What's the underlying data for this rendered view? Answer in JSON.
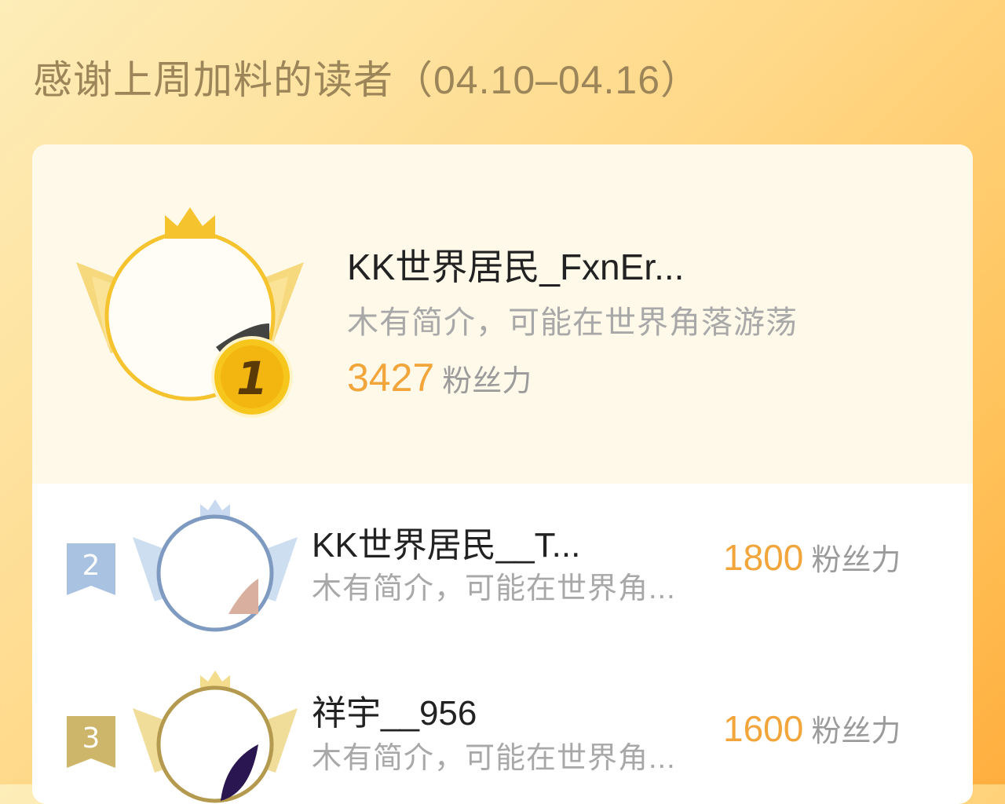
{
  "header": {
    "title": "感谢上周加料的读者（04.10–04.16）"
  },
  "colors": {
    "accent": "#f2a53a",
    "gold": "#f5c32e",
    "silver": "#7e9ac0",
    "bronze": "#b49a4e"
  },
  "unit_label": "粉丝力",
  "leaders": [
    {
      "rank": "1",
      "name": "KK世界居民_FxnEr...",
      "bio": "木有简介，可能在世界角落游荡",
      "score": "3427",
      "rank_icon": "gold-medal-icon"
    },
    {
      "rank": "2",
      "name": "KK世界居民__T...",
      "bio": "木有简介，可能在世界角...",
      "score": "1800",
      "rank_icon": "silver-ribbon-icon"
    },
    {
      "rank": "3",
      "name": "祥宇__956",
      "bio": "木有简介，可能在世界角...",
      "score": "1600",
      "rank_icon": "bronze-ribbon-icon"
    }
  ]
}
